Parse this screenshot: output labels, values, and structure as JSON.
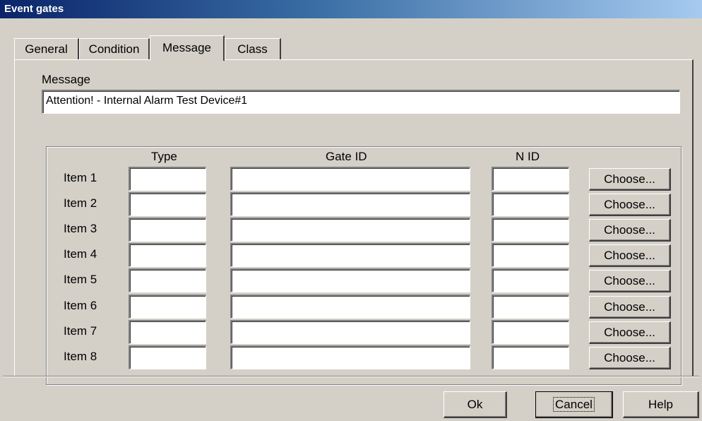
{
  "window": {
    "title": "Event gates"
  },
  "tabs": [
    {
      "label": "General",
      "active": false
    },
    {
      "label": "Condition",
      "active": false
    },
    {
      "label": "Message",
      "active": true
    },
    {
      "label": "Class",
      "active": false
    }
  ],
  "message": {
    "label": "Message",
    "value": "Attention! - Internal Alarm Test Device#1"
  },
  "grid": {
    "headers": {
      "type": "Type",
      "gate_id": "Gate ID",
      "n_id": "N ID"
    },
    "choose_label": "Choose...",
    "items": [
      {
        "label": "Item 1",
        "type": "",
        "gate_id": "",
        "n_id": ""
      },
      {
        "label": "Item 2",
        "type": "",
        "gate_id": "",
        "n_id": ""
      },
      {
        "label": "Item 3",
        "type": "",
        "gate_id": "",
        "n_id": ""
      },
      {
        "label": "Item 4",
        "type": "",
        "gate_id": "",
        "n_id": ""
      },
      {
        "label": "Item 5",
        "type": "",
        "gate_id": "",
        "n_id": ""
      },
      {
        "label": "Item 6",
        "type": "",
        "gate_id": "",
        "n_id": ""
      },
      {
        "label": "Item 7",
        "type": "",
        "gate_id": "",
        "n_id": ""
      },
      {
        "label": "Item 8",
        "type": "",
        "gate_id": "",
        "n_id": ""
      }
    ]
  },
  "buttons": {
    "ok": "Ok",
    "cancel": "Cancel",
    "help": "Help"
  }
}
